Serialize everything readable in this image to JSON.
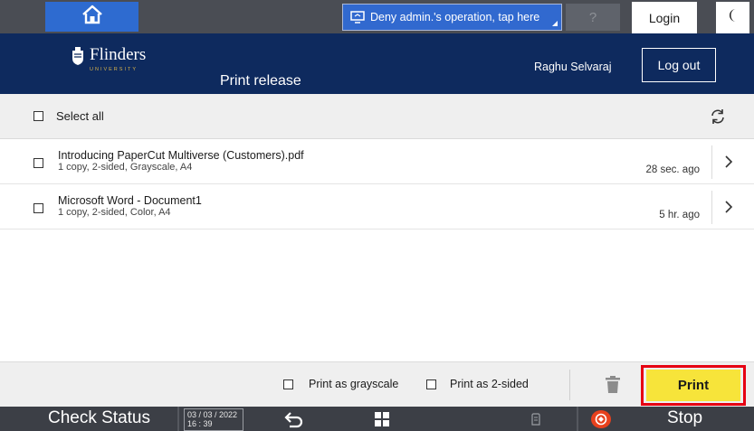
{
  "system_bar": {
    "deny_admin_label": "Deny admin.'s operation, tap here",
    "help_label": "?",
    "login_label": "Login"
  },
  "header": {
    "logo_name": "Flinders",
    "logo_sub": "UNIVERSITY",
    "page_title": "Print release",
    "user_name": "Raghu Selvaraj",
    "logout_label": "Log out"
  },
  "list": {
    "select_all_label": "Select all",
    "jobs": [
      {
        "title": "Introducing PaperCut Multiverse (Customers).pdf",
        "details": "1 copy, 2-sided, Grayscale, A4",
        "time": "28 sec. ago"
      },
      {
        "title": "Microsoft Word - Document1",
        "details": "1 copy, 2-sided, Color, A4",
        "time": "5 hr. ago"
      }
    ]
  },
  "actions": {
    "grayscale_label": "Print as grayscale",
    "two_sided_label": "Print as 2-sided",
    "print_label": "Print"
  },
  "bottom_bar": {
    "check_status_label": "Check Status",
    "date": "03 / 03 / 2022",
    "time": "16 : 39",
    "stop_label": "Stop"
  },
  "colors": {
    "header_bg": "#0e2a5e",
    "accent_blue": "#2e6bd0",
    "print_button": "#f7e43a",
    "highlight_outline": "#e60012",
    "stop_icon": "#e7411d"
  }
}
